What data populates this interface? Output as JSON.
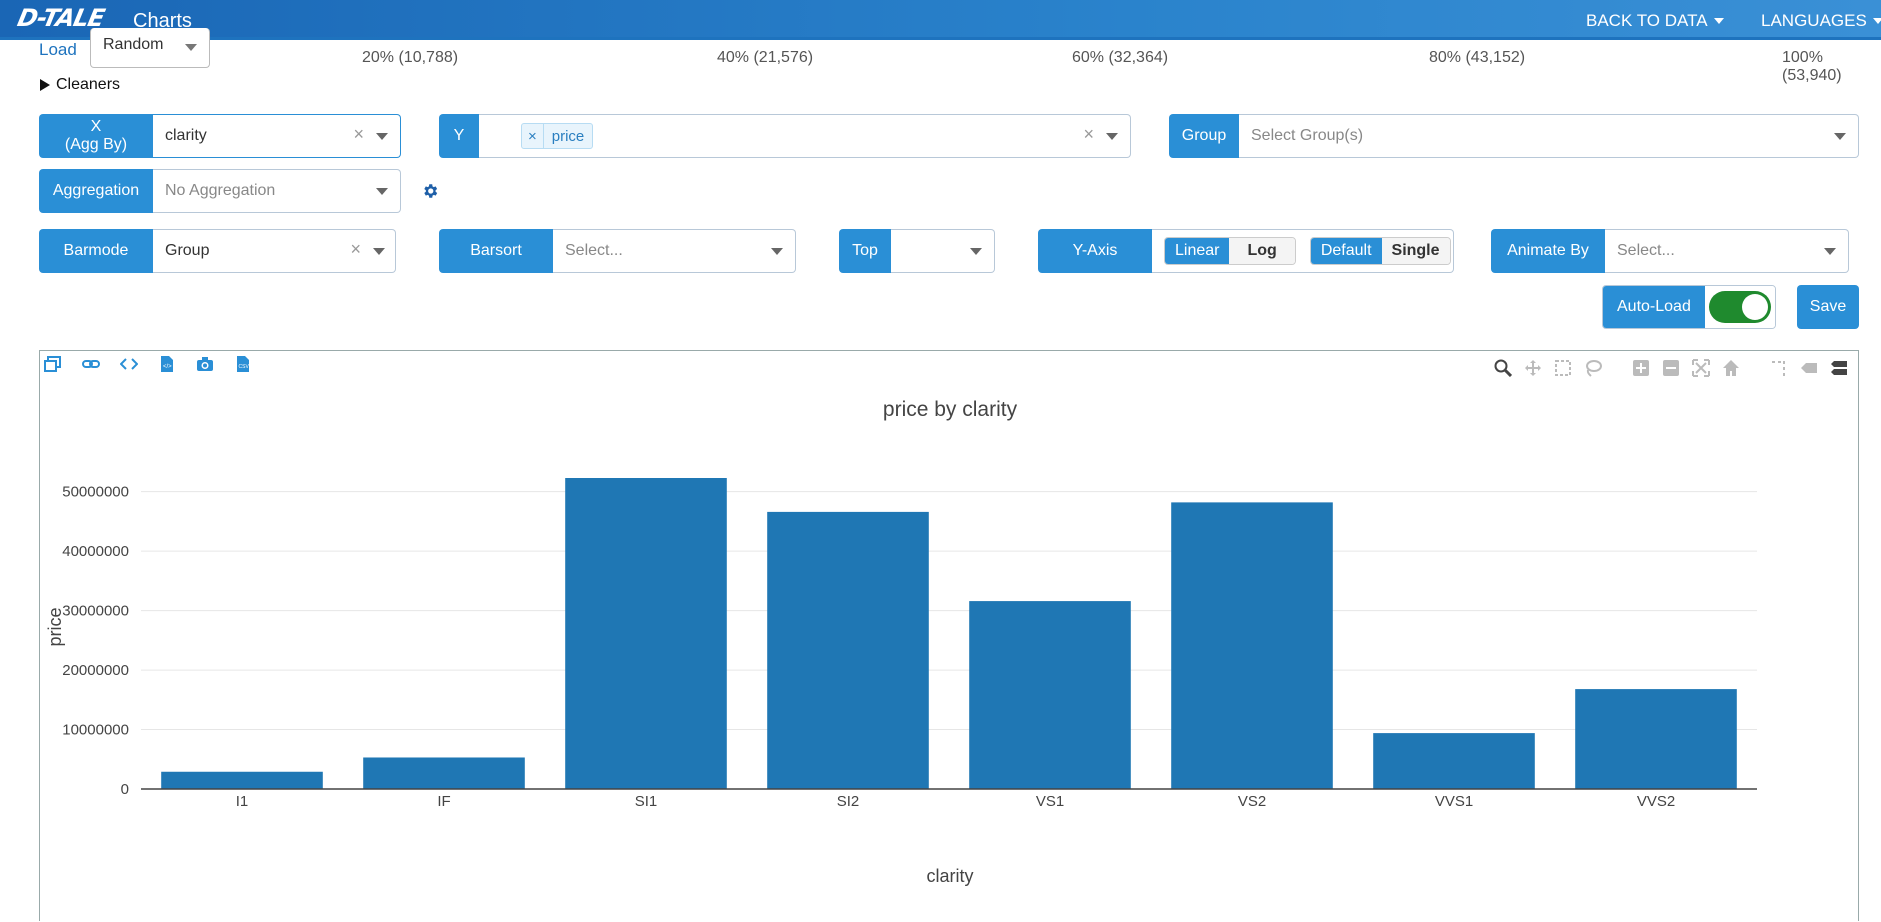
{
  "navbar": {
    "logo": "D-TALE",
    "title": "Charts",
    "back_to_data": "BACK TO DATA",
    "languages": "LANGUAGES"
  },
  "load": {
    "label": "Load",
    "value": "Random",
    "percentiles": [
      "20% (10,788)",
      "40% (21,576)",
      "60% (32,364)",
      "80% (43,152)",
      "100% (53,940)"
    ]
  },
  "cleaners": {
    "label": "Cleaners"
  },
  "controls": {
    "x_label_line1": "X",
    "x_label_line2": "(Agg By)",
    "x_value": "clarity",
    "y_label": "Y",
    "y_chip": "price",
    "group_label": "Group",
    "group_placeholder": "Select Group(s)",
    "aggregation_label": "Aggregation",
    "aggregation_placeholder": "No Aggregation",
    "barmode_label": "Barmode",
    "barmode_value": "Group",
    "barsort_label": "Barsort",
    "barsort_placeholder": "Select...",
    "top_label": "Top",
    "yaxis_label": "Y-Axis",
    "yaxis_scale_options": [
      "Linear",
      "Log"
    ],
    "yaxis_scale_selected": "Linear",
    "yaxis_mode_options": [
      "Default",
      "Single"
    ],
    "yaxis_mode_selected": "Default",
    "animate_label": "Animate By",
    "animate_placeholder": "Select...",
    "autoload_label": "Auto-Load",
    "autoload_on": true,
    "save_label": "Save"
  },
  "icons": {
    "chart_toolbar": [
      "popup-icon",
      "link-icon",
      "code-icon",
      "export-html-icon",
      "camera-icon",
      "export-csv-icon"
    ],
    "modebar": [
      "zoom-icon",
      "pan-icon",
      "box-select-icon",
      "lasso-icon",
      "zoom-in-icon",
      "zoom-out-icon",
      "autoscale-icon",
      "reset-axes-icon",
      "spike-lines-icon",
      "hover-closest-icon",
      "hover-compare-icon"
    ]
  },
  "chart_data": {
    "type": "bar",
    "title": "price by clarity",
    "xlabel": "clarity",
    "ylabel": "price",
    "categories": [
      "I1",
      "IF",
      "SI1",
      "SI2",
      "VS1",
      "VS2",
      "VVS1",
      "VVS2"
    ],
    "values": [
      2900000,
      5300000,
      52300000,
      46600000,
      31600000,
      48200000,
      9400000,
      16800000
    ],
    "ylim": [
      0,
      52300000
    ],
    "yticks": [
      0,
      10000000,
      20000000,
      30000000,
      40000000,
      50000000
    ],
    "ytick_labels": [
      "0",
      "10000000",
      "20000000",
      "30000000",
      "40000000",
      "50000000"
    ],
    "grid": true,
    "bar_color": "#1f77b4"
  }
}
